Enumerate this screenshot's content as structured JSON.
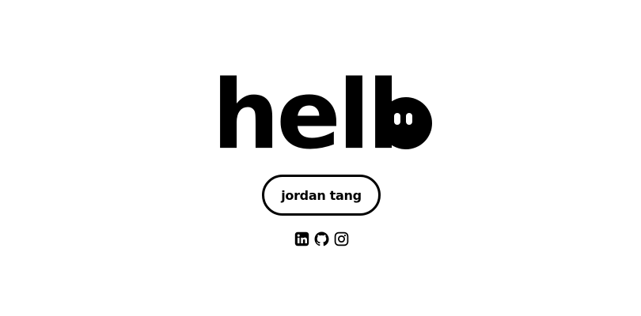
{
  "hero": {
    "text": "hell",
    "face_letter_description": "o"
  },
  "name_button": {
    "label": "jordan tang"
  },
  "socials": [
    {
      "icon": "linkedin-icon"
    },
    {
      "icon": "github-icon"
    },
    {
      "icon": "instagram-icon"
    }
  ],
  "colors": {
    "background": "#ffffff",
    "foreground": "#000000"
  }
}
